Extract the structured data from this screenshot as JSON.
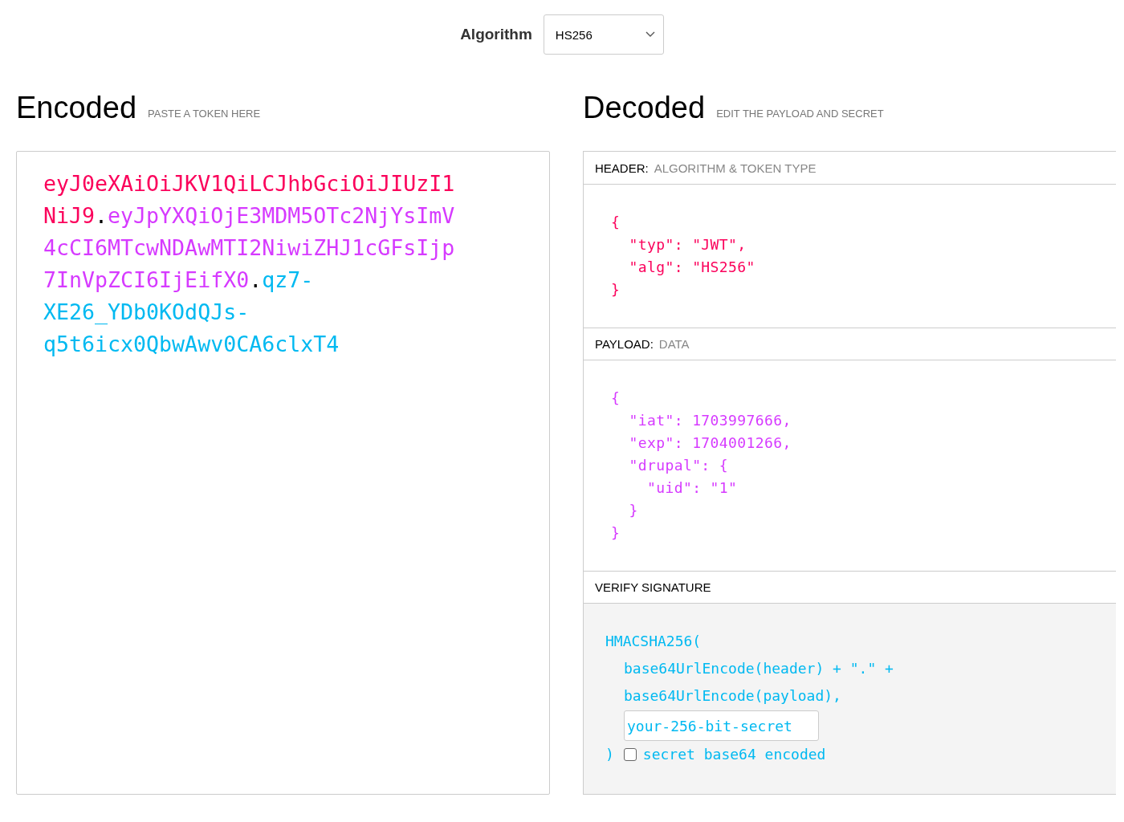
{
  "algorithm": {
    "label": "Algorithm",
    "value": "HS256"
  },
  "encoded": {
    "title": "Encoded",
    "subtitle": "PASTE A TOKEN HERE",
    "separator": ".",
    "parts": [
      {
        "text": "eyJ0eXAiOiJKV1QiLCJhbGciOiJIUzI1NiJ9",
        "color": "#fb015b"
      },
      {
        "text": "eyJpYXQiOjE3MDM5OTc2NjYsImV4cCI6MTcwNDAwMTI2NiwiZHJ1cGFsIjp7InVpZCI6IjEifX0",
        "color": "#d63aff"
      },
      {
        "text": "qz7-XE26_YDb0KOdQJs-q5t6icx0QbwAwv0CA6clxT4",
        "color": "#00b9f1"
      }
    ]
  },
  "decoded": {
    "title": "Decoded",
    "subtitle": "EDIT THE PAYLOAD AND SECRET",
    "sections": [
      {
        "kind": "json",
        "label": "HEADER:",
        "sublabel": "ALGORITHM & TOKEN TYPE",
        "color": "#fb015b",
        "code": "{\n  \"typ\": \"JWT\",\n  \"alg\": \"HS256\"\n}"
      },
      {
        "kind": "json",
        "label": "PAYLOAD:",
        "sublabel": "DATA",
        "color": "#d63aff",
        "code": "{\n  \"iat\": 1703997666,\n  \"exp\": 1704001266,\n  \"drupal\": {\n    \"uid\": \"1\"\n  }\n}"
      },
      {
        "kind": "signature",
        "label": "VERIFY SIGNATURE",
        "color": "#00b9f1",
        "function": "HMACSHA256(",
        "lines": [
          "base64UrlEncode(header) + \".\" +",
          "base64UrlEncode(payload),"
        ],
        "secret": "your-256-bit-secret",
        "close": ")",
        "checkbox": {
          "label": "secret base64 encoded",
          "checked": false
        }
      }
    ]
  }
}
